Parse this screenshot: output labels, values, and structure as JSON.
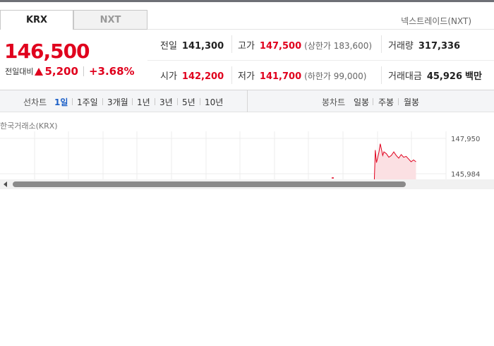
{
  "tabs": [
    {
      "label": "KRX",
      "active": true
    },
    {
      "label": "NXT",
      "active": false
    }
  ],
  "nxt_link": "넥스트레이드(NXT)",
  "price": {
    "current": "146,500",
    "change_label": "전일대비",
    "change_value": "5,200",
    "change_pct": "+3.68%"
  },
  "stats": {
    "prev_close": {
      "label": "전일",
      "value": "141,300"
    },
    "high": {
      "label": "고가",
      "value": "147,500",
      "sub": "(상한가 183,600)"
    },
    "volume": {
      "label": "거래량",
      "value": "317,336"
    },
    "open": {
      "label": "시가",
      "value": "142,200"
    },
    "low": {
      "label": "저가",
      "value": "141,700",
      "sub": "(하한가 99,000)"
    },
    "turnover": {
      "label": "거래대금",
      "value": "45,926",
      "unit": "백만"
    }
  },
  "period_bar": {
    "line_title": "선차트",
    "line_periods": [
      "1일",
      "1주일",
      "3개월",
      "1년",
      "3년",
      "5년",
      "10년"
    ],
    "line_active": "1일",
    "candle_title": "봉차트",
    "candle_periods": [
      "일봉",
      "주봉",
      "월봉"
    ]
  },
  "chart": {
    "exchange_label": "한국거래소(KRX)",
    "y_labels": [
      "147,950",
      "145,984"
    ],
    "colors": {
      "up": "#e0001d",
      "fill": "#fbe0e3",
      "grid": "#ececec"
    }
  },
  "chart_data": {
    "type": "line",
    "y_ticks": [
      147950,
      145984
    ],
    "points": [
      [
        0.0,
        145150
      ],
      [
        0.005,
        147300
      ],
      [
        0.01,
        146600
      ],
      [
        0.015,
        146900
      ],
      [
        0.02,
        147200
      ],
      [
        0.025,
        147650
      ],
      [
        0.03,
        147350
      ],
      [
        0.035,
        147000
      ],
      [
        0.04,
        147200
      ],
      [
        0.05,
        147100
      ],
      [
        0.06,
        146900
      ],
      [
        0.07,
        147000
      ],
      [
        0.08,
        147200
      ],
      [
        0.09,
        147000
      ],
      [
        0.1,
        146850
      ],
      [
        0.11,
        147050
      ],
      [
        0.12,
        146900
      ],
      [
        0.13,
        146950
      ],
      [
        0.14,
        146800
      ],
      [
        0.15,
        146650
      ],
      [
        0.16,
        146750
      ],
      [
        0.17,
        146650
      ]
    ]
  }
}
